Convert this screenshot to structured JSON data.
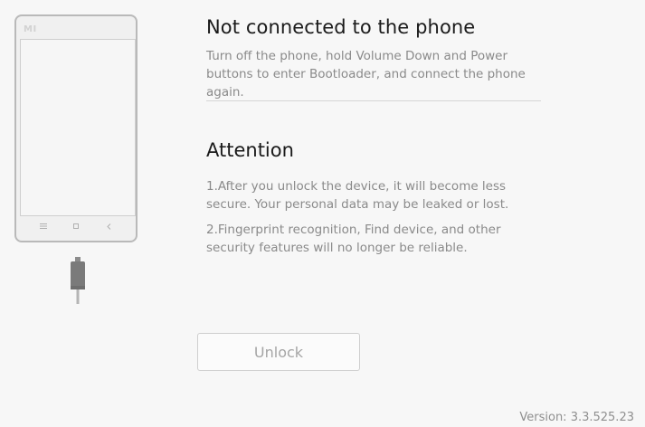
{
  "phone": {
    "brand_logo": "MI",
    "nav_icons": [
      "menu-icon",
      "home-icon",
      "back-icon"
    ]
  },
  "status": {
    "title": "Not connected to the phone",
    "instructions": "Turn off the phone, hold Volume Down and Power buttons to enter Bootloader, and connect the phone again."
  },
  "attention": {
    "title": "Attention",
    "notes": [
      "1.After you unlock the device, it will become less secure. Your personal data may be leaked or lost.",
      "2.Fingerprint recognition, Find device, and other security features will no longer be reliable."
    ]
  },
  "actions": {
    "unlock_label": "Unlock",
    "unlock_enabled": false
  },
  "footer": {
    "version": "Version: 3.3.525.23"
  },
  "colors": {
    "background": "#f7f7f7",
    "muted_text": "#8a8a8a",
    "disabled_button_text": "#a5a5a5"
  }
}
